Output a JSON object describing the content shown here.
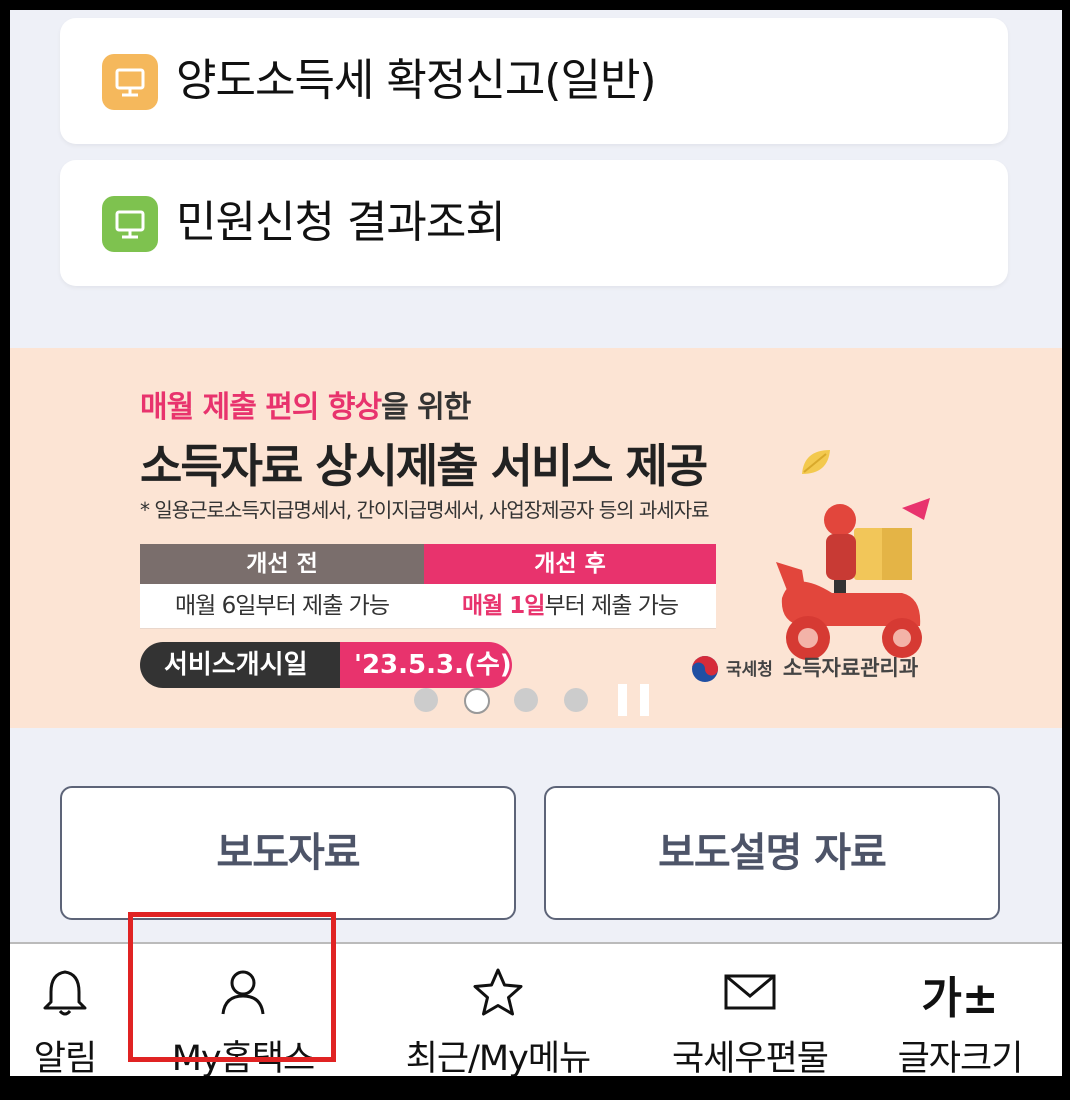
{
  "menu_items": [
    {
      "label": "양도소득세 확정신고(일반)",
      "icon": "monitor-icon",
      "icon_color": "#f5b85c"
    },
    {
      "label": "민원신청 결과조회",
      "icon": "monitor-icon",
      "icon_color": "#7ec24f"
    }
  ],
  "banner": {
    "headline_highlight": "매월 제출 편의 향상",
    "headline_rest": "을 위한",
    "title": "소득자료 상시제출 서비스 제공",
    "note": "* 일용근로소득지급명세서, 간이지급명세서, 사업장제공자 등의 과세자료",
    "before_label": "개선 전",
    "before_text": "매월 6일부터 제출 가능",
    "after_label": "개선 후",
    "after_highlight": "매월 1일",
    "after_rest": "부터 제출 가능",
    "start_label": "서비스개시일",
    "start_date": "'23.5.3.(수)",
    "agency": "국세청",
    "department": "소득자료관리과",
    "slide_count": 4,
    "active_slide": 2,
    "colors": {
      "pink": "#e8336d",
      "dark": "#333333",
      "gray": "#7a6e6c",
      "background": "#fce4d4"
    }
  },
  "buttons": {
    "press_release": "보도자료",
    "press_explanation": "보도설명 자료"
  },
  "bottom_nav": [
    {
      "label": "알림",
      "icon": "bell-icon"
    },
    {
      "label": "My홈택스",
      "icon": "user-icon",
      "highlighted": true
    },
    {
      "label": "최근/My메뉴",
      "icon": "star-icon"
    },
    {
      "label": "국세우편물",
      "icon": "envelope-icon"
    },
    {
      "label": "글자크기",
      "icon": "font-size-icon",
      "icon_text": "가±"
    }
  ],
  "highlight_color": "#e02323"
}
